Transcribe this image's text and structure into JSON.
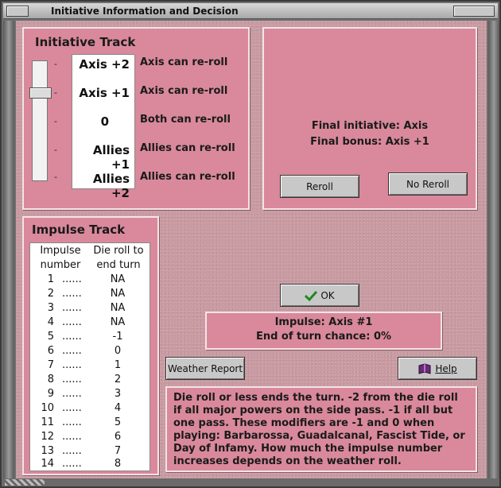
{
  "window": {
    "title": "Initiative Information and Decision"
  },
  "initiative_track": {
    "title": "Initiative Track",
    "tick_mark": "-",
    "levels": [
      {
        "label": "Axis +2",
        "desc": "Axis can re-roll"
      },
      {
        "label": "Axis +1",
        "desc": "Axis can re-roll"
      },
      {
        "label": "0",
        "desc": "Both can re-roll"
      },
      {
        "label": "Allies +1",
        "desc": "Allies can re-roll"
      },
      {
        "label": "Allies +2",
        "desc": "Allies can re-roll"
      }
    ],
    "selected": "Axis +1"
  },
  "decision": {
    "final_initiative": "Final initiative: Axis",
    "final_bonus": "Final bonus: Axis +1",
    "reroll_label": "Reroll",
    "no_reroll_label": "No Reroll"
  },
  "impulse_track": {
    "title": "Impulse Track",
    "col1_header": [
      "Impulse",
      "number"
    ],
    "col2_header": [
      "Die roll to",
      "end turn"
    ],
    "dots": "......",
    "rows": [
      {
        "n": "1",
        "v": "NA"
      },
      {
        "n": "2",
        "v": "NA"
      },
      {
        "n": "3",
        "v": "NA"
      },
      {
        "n": "4",
        "v": "NA"
      },
      {
        "n": "5",
        "v": "-1"
      },
      {
        "n": "6",
        "v": "0"
      },
      {
        "n": "7",
        "v": "1"
      },
      {
        "n": "8",
        "v": "2"
      },
      {
        "n": "9",
        "v": "3"
      },
      {
        "n": "10",
        "v": "4"
      },
      {
        "n": "11",
        "v": "5"
      },
      {
        "n": "12",
        "v": "6"
      },
      {
        "n": "13",
        "v": "7"
      },
      {
        "n": "14",
        "v": "8"
      }
    ]
  },
  "ok_label": "OK",
  "status": {
    "impulse": "Impulse: Axis #1",
    "end_chance": "End of turn chance: 0%"
  },
  "weather_label": "Weather Report",
  "help_label": "Help",
  "description": "Die roll or less ends the turn.  -2 from the die roll if all major powers on the side pass.  -1 if all but one pass.  These modifiers are -1 and 0 when playing: Barbarossa, Guadalcanal, Fascist Tide, or Day of Infamy.  How much the impulse number increases depends on the weather roll.",
  "colors": {
    "panel": "#d9899b",
    "background": "#c89aa2",
    "ok_check": "#1f8a1f",
    "help_book": "#6a2a7a"
  },
  "icons": {
    "ok": "check-icon",
    "help": "book-icon"
  }
}
